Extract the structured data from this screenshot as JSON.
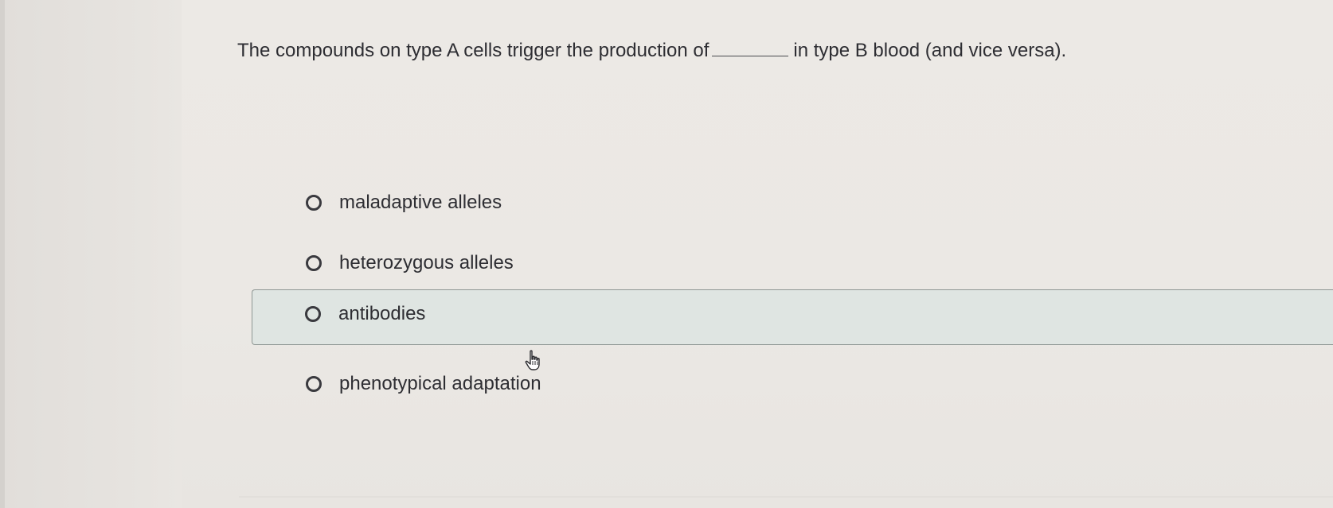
{
  "question": {
    "text_before": "The compounds on type A cells trigger the production of",
    "text_after": "in type B blood (and vice versa)."
  },
  "options": [
    {
      "label": "maladaptive alleles",
      "selected": false
    },
    {
      "label": "heterozygous alleles",
      "selected": false
    },
    {
      "label": "antibodies",
      "selected": false,
      "highlighted": true
    },
    {
      "label": "phenotypical adaptation",
      "selected": false
    }
  ],
  "icons": {
    "radio": "radio-button-empty-icon",
    "cursor": "hand-pointer-icon"
  }
}
